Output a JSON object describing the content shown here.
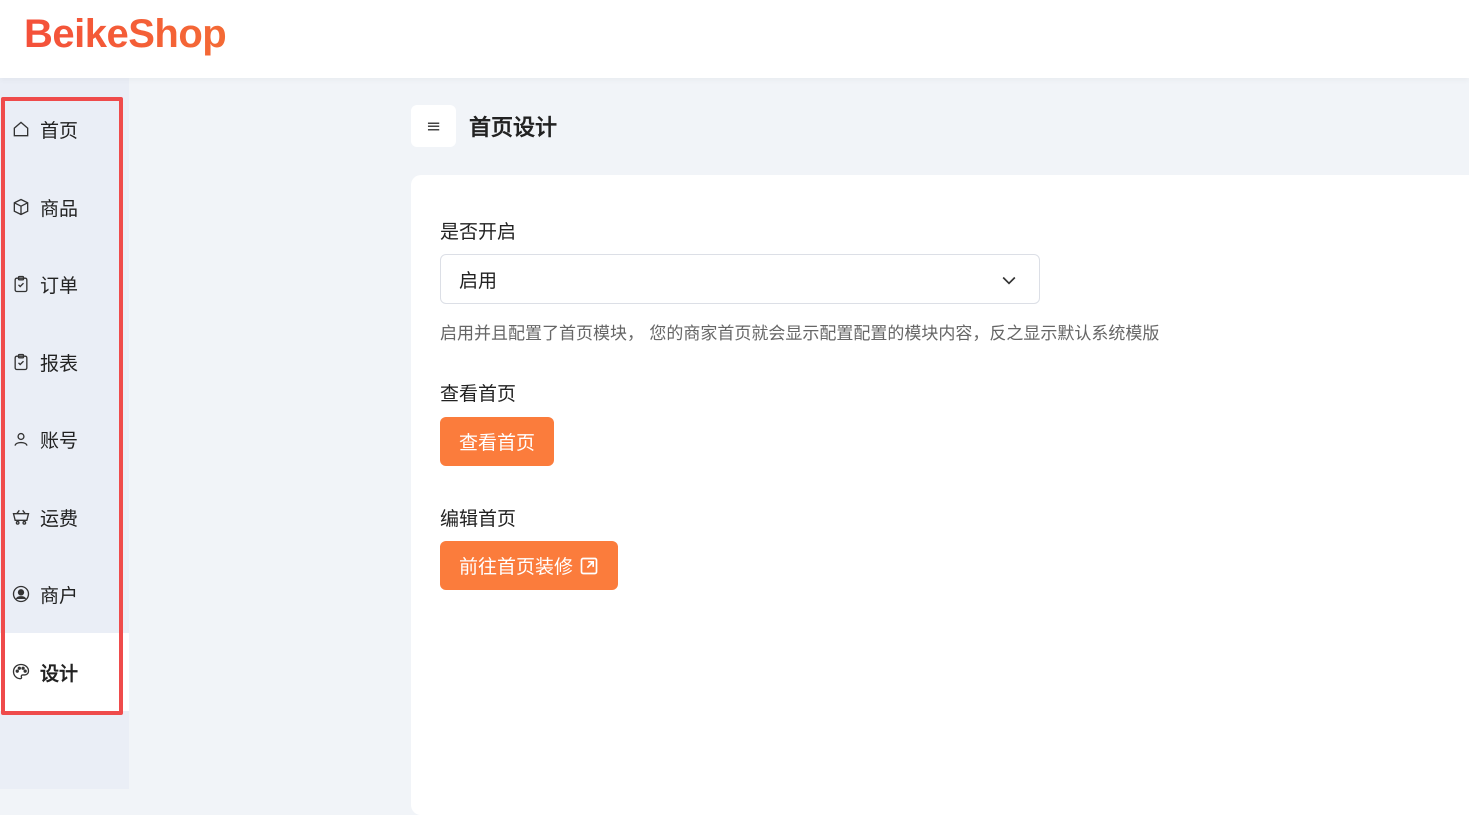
{
  "brand": {
    "logo_text": "BeikeShop",
    "accent": "#fb7c3c",
    "logo_color": "#f2592f"
  },
  "sidebar": {
    "items": [
      {
        "label": "首页",
        "icon": "home-icon"
      },
      {
        "label": "商品",
        "icon": "box-icon"
      },
      {
        "label": "订单",
        "icon": "clipboard-check-icon"
      },
      {
        "label": "报表",
        "icon": "clipboard-check-icon"
      },
      {
        "label": "账号",
        "icon": "user-icon"
      },
      {
        "label": "运费",
        "icon": "cart-icon"
      },
      {
        "label": "商户",
        "icon": "user-circle-icon"
      },
      {
        "label": "设计",
        "icon": "palette-icon",
        "active": true
      }
    ]
  },
  "header": {
    "menu_icon": "≡",
    "title": "首页设计"
  },
  "form": {
    "enable_label": "是否开启",
    "enable_value": "启用",
    "enable_help": "启用并且配置了首页模块， 您的商家首页就会显示配置配置的模块内容，反之显示默认系统模版",
    "view_label": "查看首页",
    "view_button": "查看首页",
    "edit_label": "编辑首页",
    "edit_button": "前往首页装修"
  }
}
